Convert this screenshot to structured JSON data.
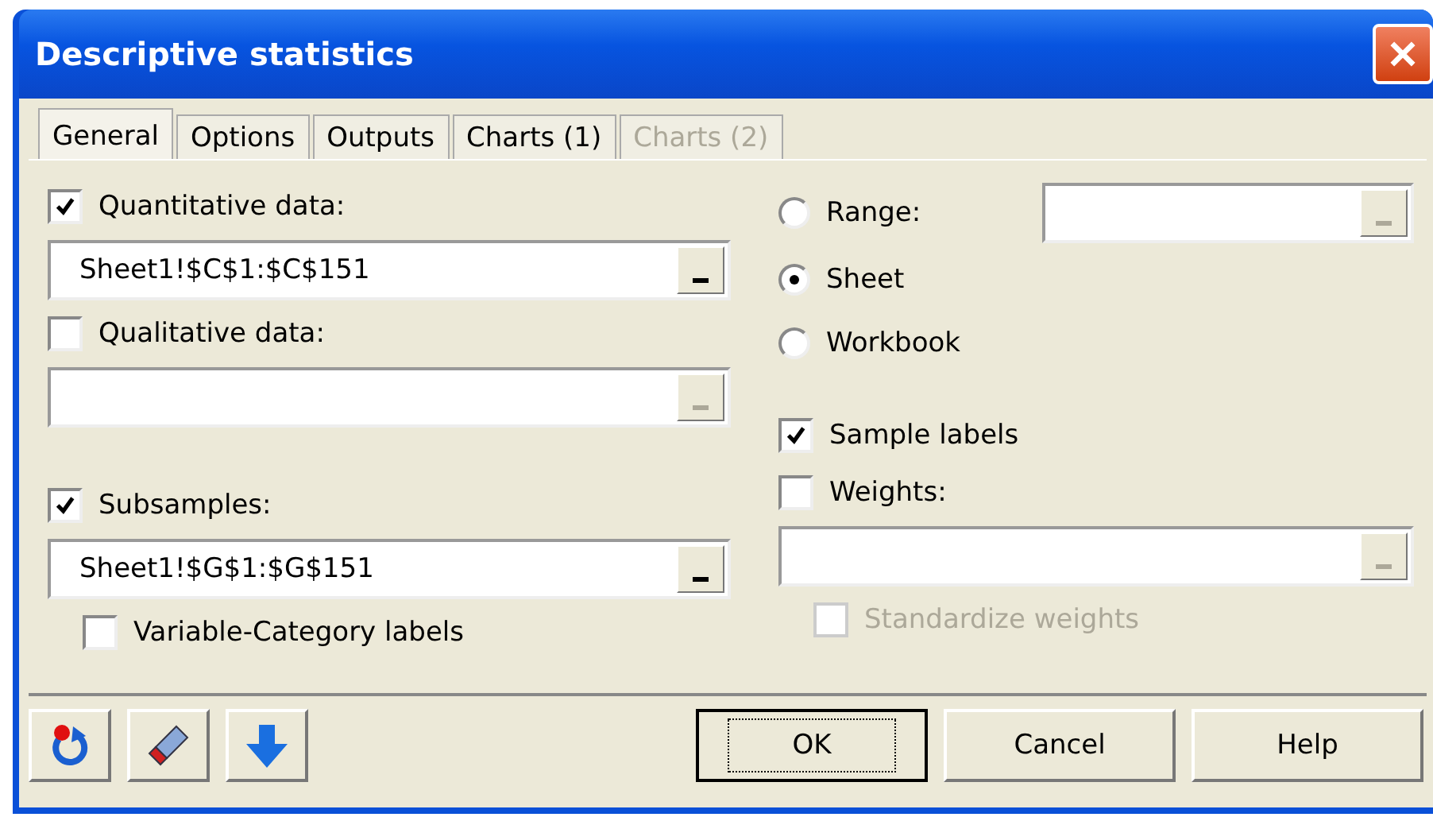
{
  "window": {
    "title": "Descriptive statistics"
  },
  "tabs": [
    {
      "label": "General",
      "selected": true,
      "disabled": false
    },
    {
      "label": "Options",
      "selected": false,
      "disabled": false
    },
    {
      "label": "Outputs",
      "selected": false,
      "disabled": false
    },
    {
      "label": "Charts (1)",
      "selected": false,
      "disabled": false
    },
    {
      "label": "Charts (2)",
      "selected": false,
      "disabled": true
    }
  ],
  "left": [
    {
      "kind": "checkbox",
      "label": "Quantitative data:",
      "checked": true
    },
    {
      "kind": "field",
      "value": "Sheet1!$C$1:$C$151",
      "disabled": false
    },
    {
      "kind": "checkbox",
      "label": "Qualitative data:",
      "checked": false
    },
    {
      "kind": "field",
      "disabled": true
    },
    {
      "kind": "gap"
    },
    {
      "kind": "checkbox",
      "label": "Subsamples:",
      "checked": true
    },
    {
      "kind": "field",
      "value": "Sheet1!$G$1:$G$151",
      "disabled": false
    }
  ],
  "left_option": {
    "label": "Variable-Category labels",
    "checked": false,
    "disabled": false
  },
  "sources": [
    {
      "label": "Range:",
      "selected": false,
      "field": {
        "disabled": true
      }
    },
    {
      "label": "Sheet",
      "selected": true
    },
    {
      "label": "Workbook",
      "selected": false
    }
  ],
  "right": [
    {
      "kind": "checkbox",
      "label": "Sample labels",
      "checked": true
    },
    {
      "kind": "checkbox",
      "label": "Weights:",
      "checked": false
    },
    {
      "kind": "field",
      "disabled": true
    }
  ],
  "right_option": {
    "label": "Standardize weights",
    "checked": false,
    "disabled": true
  },
  "buttons": [
    {
      "label": "OK",
      "default": true
    },
    {
      "label": "Cancel",
      "default": false
    },
    {
      "label": "Help",
      "default": false
    }
  ]
}
